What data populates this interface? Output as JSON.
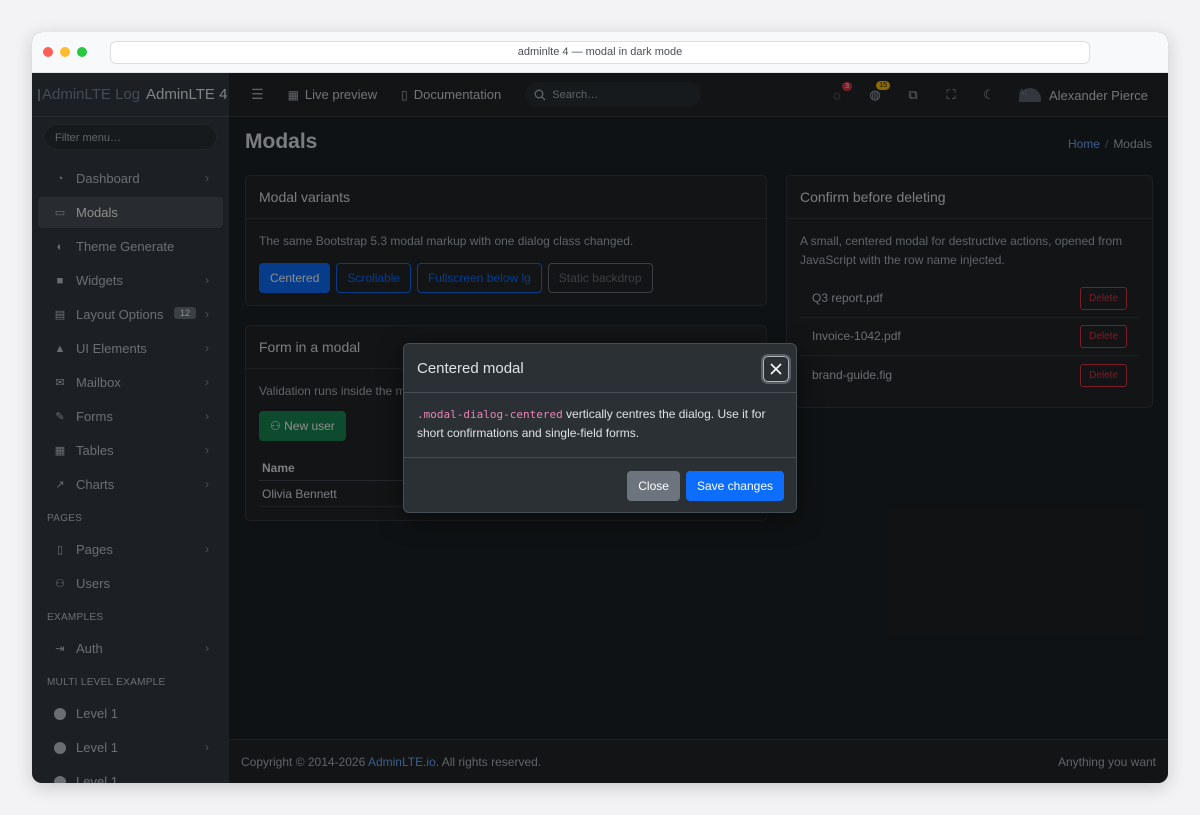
{
  "browser": {
    "address": "adminlte 4 — modal in dark mode"
  },
  "sidebar": {
    "logo_alt": "AdminLTE Logo",
    "brand": "AdminLTE 4",
    "filter_placeholder": "Filter menu…",
    "items": [
      {
        "label": "Dashboard",
        "icon": "gauge-icon",
        "chevron": true
      },
      {
        "label": "Modals",
        "icon": "file-icon",
        "active": true
      },
      {
        "label": "Theme Generate",
        "icon": "palette-icon"
      },
      {
        "label": "Widgets",
        "icon": "box-icon",
        "chevron": true
      },
      {
        "label": "Layout Options",
        "icon": "clipboard-icon",
        "badge": "12",
        "chevron": true
      },
      {
        "label": "UI Elements",
        "icon": "tree-icon",
        "chevron": true
      },
      {
        "label": "Mailbox",
        "icon": "envelope-icon",
        "chevron": true
      },
      {
        "label": "Forms",
        "icon": "pencil-square-icon",
        "chevron": true
      },
      {
        "label": "Tables",
        "icon": "table-icon",
        "chevron": true
      },
      {
        "label": "Charts",
        "icon": "chart-line-icon",
        "chevron": true
      }
    ],
    "header_pages": "PAGES",
    "pages_items": [
      {
        "label": "Pages",
        "icon": "document-icon",
        "chevron": true
      },
      {
        "label": "Users",
        "icon": "people-icon"
      }
    ],
    "header_examples": "EXAMPLES",
    "examples_items": [
      {
        "label": "Auth",
        "icon": "login-icon",
        "chevron": true
      }
    ],
    "header_multi": "MULTI LEVEL EXAMPLE",
    "multi_items": [
      {
        "label": "Level 1"
      },
      {
        "label": "Level 1",
        "chevron": true
      },
      {
        "label": "Level 1"
      }
    ]
  },
  "topbar": {
    "live_preview": "Live preview",
    "documentation": "Documentation",
    "search_placeholder": "Search…",
    "messages_count": "3",
    "notifications_count": "15",
    "user_name": "Alexander Pierce",
    "avatar_alt": "Al"
  },
  "page": {
    "title": "Modals",
    "breadcrumb_home": "Home",
    "breadcrumb_sep": "/",
    "breadcrumb_current": "Modals"
  },
  "variants_card": {
    "title": "Modal variants",
    "text": "The same Bootstrap 5.3 modal markup with one dialog class changed.",
    "buttons": [
      "Centered",
      "Scrollable",
      "Fullscreen below lg",
      "Static backdrop"
    ]
  },
  "form_card": {
    "title": "Form in a modal",
    "text": "Validation runs inside the m",
    "new_user": "New user",
    "col_name": "Name",
    "row_name": "Olivia Bennett"
  },
  "delete_card": {
    "title": "Confirm before deleting",
    "text": "A small, centered modal for destructive actions, opened from JavaScript with the row name injected.",
    "files": [
      "Q3 report.pdf",
      "Invoice-1042.pdf",
      "brand-guide.fig"
    ],
    "delete_label": "Delete"
  },
  "modal": {
    "title": "Centered modal",
    "code": ".modal-dialog-centered",
    "body_rest": " vertically centres the dialog. Use it for short confirmations and single-field forms.",
    "close_label": "Close",
    "save_label": "Save changes"
  },
  "footer": {
    "copyright": "Copyright © 2014-2026 ",
    "link": "AdminLTE.io",
    "rights": ". All rights reserved.",
    "right_text": "Anything you want"
  }
}
